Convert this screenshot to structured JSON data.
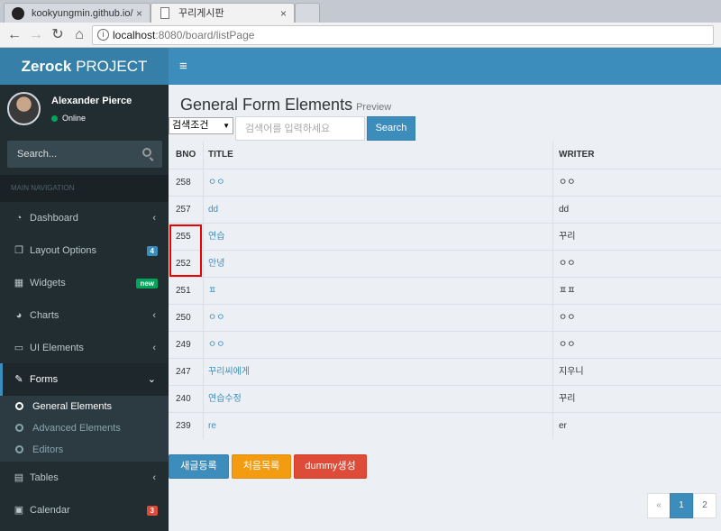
{
  "browser": {
    "tabs": [
      {
        "label": "kookyungmin.github.io/"
      },
      {
        "label": "꾸리게시판"
      },
      {
        "label": ""
      }
    ],
    "close_glyph": "×",
    "url_host": "localhost",
    "url_rest": ":8080/board/listPage",
    "icons": {
      "back": "back-arrow-icon",
      "forward": "forward-arrow-icon",
      "reload": "reload-icon",
      "home": "home-icon",
      "info": "info-icon"
    }
  },
  "header": {
    "logo_bold": "Zerock",
    "logo_rest": " PROJECT"
  },
  "sidebar": {
    "user_name": "Alexander Pierce",
    "user_status": "Online",
    "search_placeholder": "Search...",
    "section_header": "MAIN NAVIGATION",
    "items": [
      {
        "label": "Dashboard",
        "icon": "dashboard-icon",
        "glyph": "◔",
        "chevron": "‹"
      },
      {
        "label": "Layout Options",
        "icon": "files-icon",
        "glyph": "❐",
        "badge": "4",
        "badge_color": "#3c8dbc"
      },
      {
        "label": "Widgets",
        "icon": "th-icon",
        "glyph": "▦",
        "badge": "new",
        "badge_color": "#00a65a"
      },
      {
        "label": "Charts",
        "icon": "pie-chart-icon",
        "glyph": "◕",
        "chevron": "‹"
      },
      {
        "label": "UI Elements",
        "icon": "laptop-icon",
        "glyph": "▭",
        "chevron": "‹"
      },
      {
        "label": "Forms",
        "icon": "edit-icon",
        "glyph": "✎",
        "chevron": "⌄",
        "active": true
      },
      {
        "label": "Tables",
        "icon": "table-icon",
        "glyph": "▤",
        "chevron": "‹"
      },
      {
        "label": "Calendar",
        "icon": "calendar-icon",
        "glyph": "▣",
        "badge": "3",
        "badge_color": "#dd4b39"
      }
    ],
    "submenu": [
      {
        "label": "General Elements",
        "active": true
      },
      {
        "label": "Advanced Elements"
      },
      {
        "label": "Editors"
      }
    ]
  },
  "content": {
    "title": "General Form Elements",
    "subtitle": "Preview",
    "search": {
      "select_value": "검색조건",
      "keyword_placeholder": "검색어를 입력하세요",
      "button": "Search"
    },
    "table": {
      "columns": [
        "BNO",
        "TITLE",
        "WRITER"
      ],
      "rows": [
        {
          "bno": "258",
          "title": "ㅇㅇ",
          "writer": "ㅇㅇ"
        },
        {
          "bno": "257",
          "title": "dd",
          "writer": "dd"
        },
        {
          "bno": "255",
          "title": "연습",
          "writer": "꾸리"
        },
        {
          "bno": "252",
          "title": "안녕",
          "writer": "ㅇㅇ"
        },
        {
          "bno": "251",
          "title": "ㅍ",
          "writer": "ㅍㅍ"
        },
        {
          "bno": "250",
          "title": "ㅇㅇ",
          "writer": "ㅇㅇ"
        },
        {
          "bno": "249",
          "title": "ㅇㅇ",
          "writer": "ㅇㅇ"
        },
        {
          "bno": "247",
          "title": "꾸리씨에게",
          "writer": "지우니"
        },
        {
          "bno": "240",
          "title": "연습수정",
          "writer": "꾸리"
        },
        {
          "bno": "239",
          "title": "re",
          "writer": "er"
        }
      ]
    },
    "buttons": {
      "new_post": "새글등록",
      "first_list": "처음목록",
      "dummy": "dummy생성"
    },
    "pagination": {
      "prev": "«",
      "pages": [
        "1",
        "2"
      ],
      "current": "1"
    }
  }
}
